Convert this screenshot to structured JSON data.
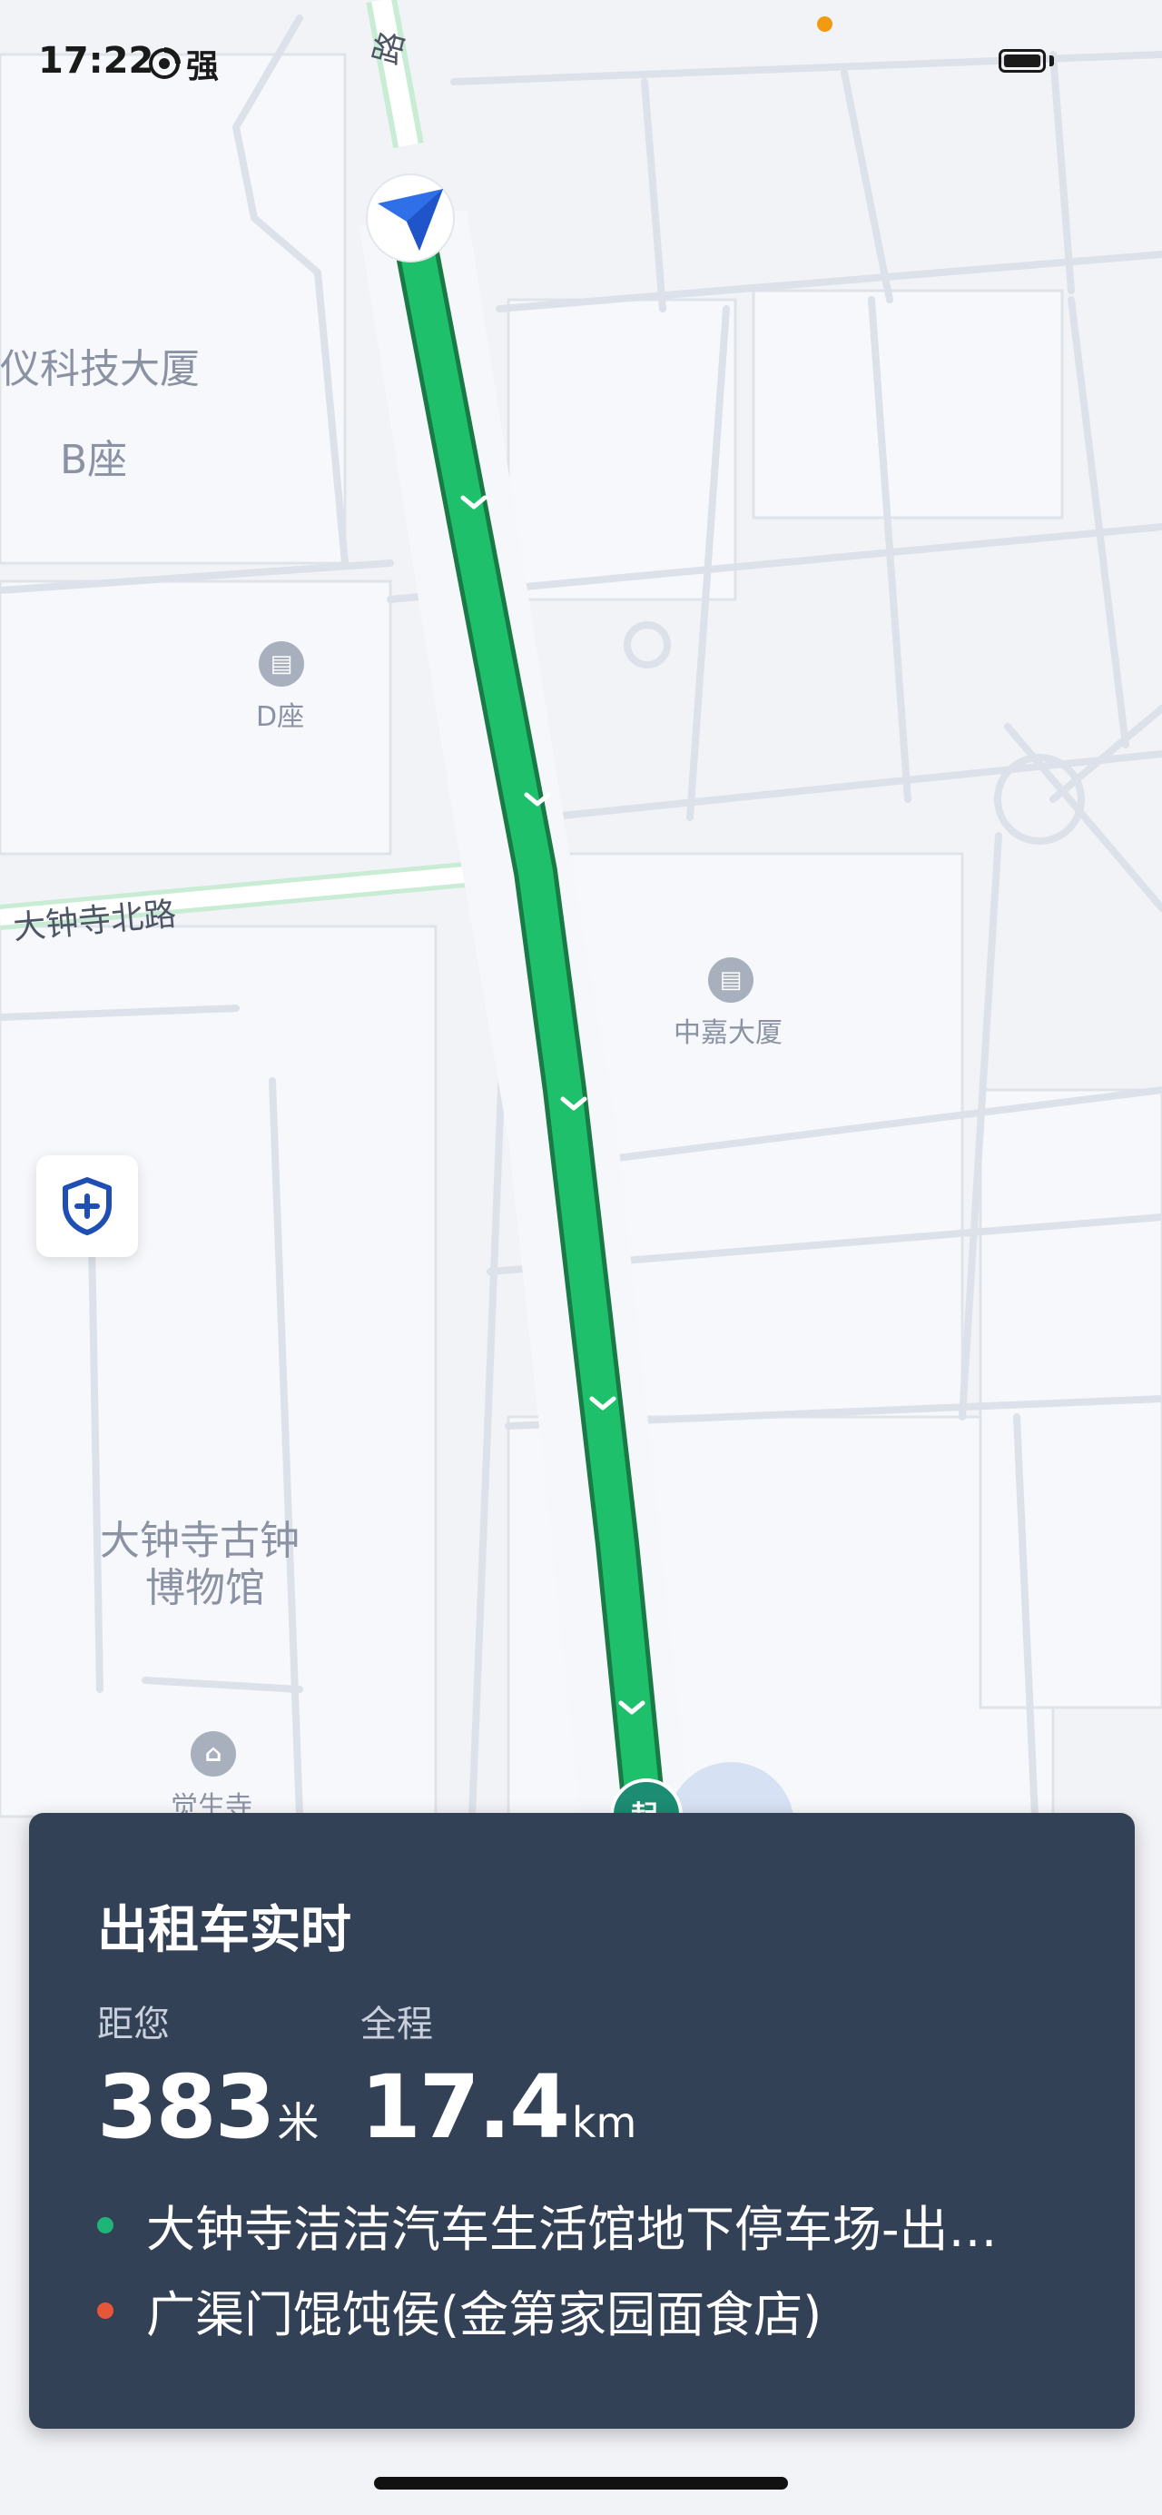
{
  "status_bar": {
    "time": "17:22",
    "network_label": "强"
  },
  "map": {
    "labels": {
      "building_top_left": "仪科技大厦",
      "building_b": "B座",
      "poi_d": "D座",
      "road_north": "大钟寺北路",
      "road_top": "路",
      "poi_zhongjia": "中嘉大厦",
      "museum_line1": "大钟寺古钟",
      "museum_line2": "博物馆",
      "poi_temple": "觉生寺",
      "start_marker": "起"
    }
  },
  "card": {
    "title": "出租车实时",
    "distance_label": "距您",
    "distance_value": "383",
    "distance_unit": "米",
    "total_label": "全程",
    "total_value": "17.4",
    "total_unit": "km",
    "origin": "大钟寺洁洁汽车生活馆地下停车场-出…",
    "destination": "广渠门馄饨侯(金第家园面食店)"
  },
  "colors": {
    "route": "#1fc06c",
    "card_bg": "#334157",
    "origin_dot": "#1fb578",
    "destination_dot": "#e8563a",
    "nav_arrow": "#2f6fe8"
  },
  "icons": {
    "safety": "shield-plus-icon",
    "nav": "navigation-arrow-icon",
    "poi": "building-icon"
  }
}
